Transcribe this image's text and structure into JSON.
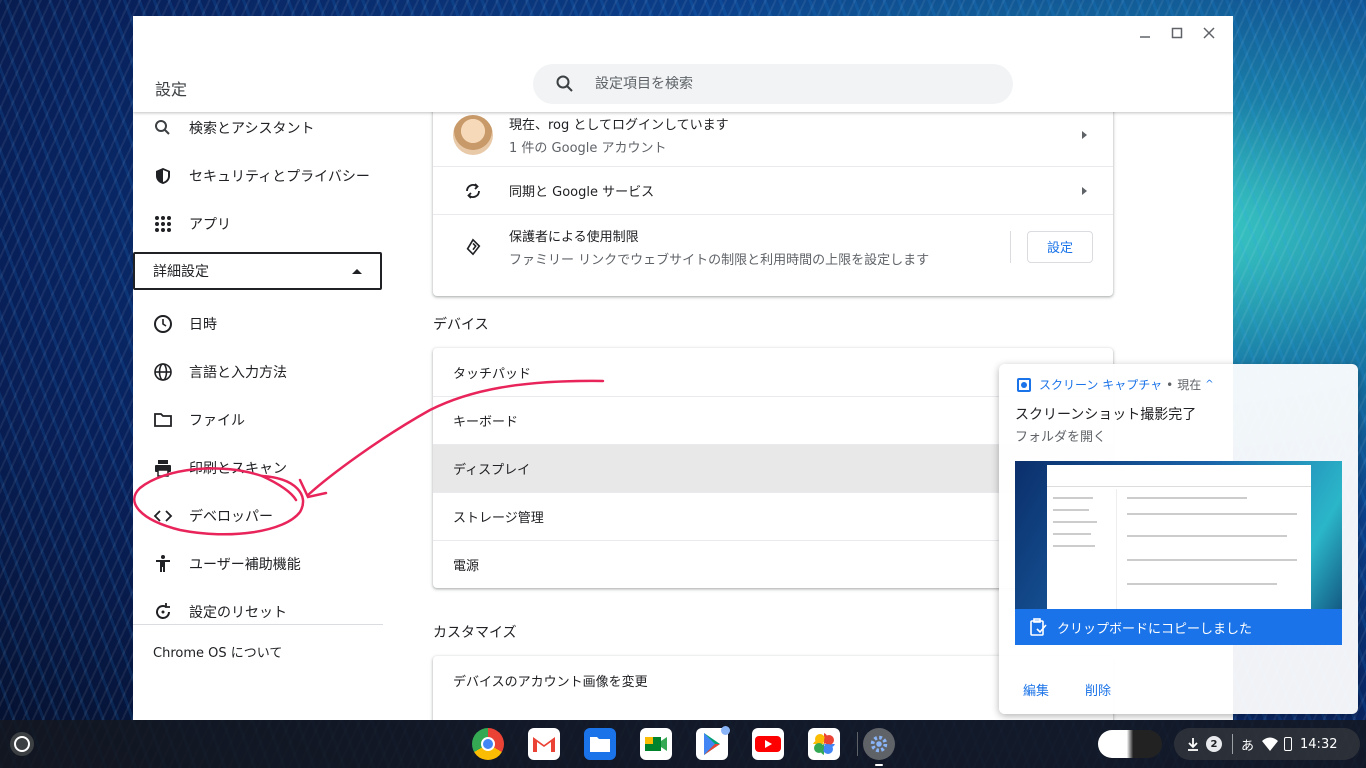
{
  "window": {
    "title": "設定",
    "search_placeholder": "設定項目を検索"
  },
  "sidebar": {
    "items_top": [
      {
        "label": "検索とアシスタント",
        "icon": "search-icon"
      },
      {
        "label": "セキュリティとプライバシー",
        "icon": "shield-icon"
      },
      {
        "label": "アプリ",
        "icon": "apps-grid-icon"
      }
    ],
    "advanced_label": "詳細設定",
    "items_advanced": [
      {
        "label": "日時",
        "icon": "clock-icon"
      },
      {
        "label": "言語と入力方法",
        "icon": "globe-icon"
      },
      {
        "label": "ファイル",
        "icon": "folder-icon"
      },
      {
        "label": "印刷とスキャン",
        "icon": "printer-icon"
      },
      {
        "label": "デベロッパー",
        "icon": "code-icon"
      },
      {
        "label": "ユーザー補助機能",
        "icon": "accessibility-icon"
      },
      {
        "label": "設定のリセット",
        "icon": "reset-icon"
      }
    ],
    "about_label": "Chrome OS について"
  },
  "people": {
    "account_title": "現在、rog としてログインしています",
    "account_sub": "1 件の Google アカウント",
    "sync_label": "同期と Google サービス",
    "parental_title": "保護者による使用制限",
    "parental_sub": "ファミリー リンクでウェブサイトの制限と利用時間の上限を設定します",
    "parental_button": "設定"
  },
  "device": {
    "section_title": "デバイス",
    "rows": [
      "タッチパッド",
      "キーボード",
      "ディスプレイ",
      "ストレージ管理",
      "電源"
    ]
  },
  "customize": {
    "section_title": "カスタマイズ",
    "rows": [
      "デバイスのアカウント画像を変更"
    ]
  },
  "notification": {
    "app_name": "スクリーン キャプチャ",
    "separator": "•",
    "time": "現在",
    "title": "スクリーンショット撮影完了",
    "subtitle": "フォルダを開く",
    "clipboard_text": "クリップボードにコピーしました",
    "actions": [
      "編集",
      "削除"
    ]
  },
  "shelf": {
    "download_count": "2",
    "ime": "あ",
    "clock": "14:32"
  },
  "colors": {
    "accent": "#1a73e8",
    "annotation": "#e8245a"
  }
}
